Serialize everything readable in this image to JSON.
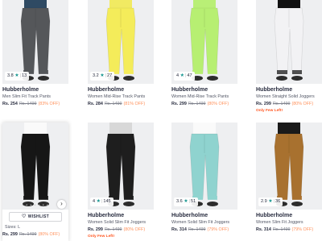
{
  "colors": {
    "accent_star": "#14958f",
    "discount": "#ff905a",
    "few_left": "#ff5722"
  },
  "products": [
    {
      "id": "p1",
      "brand": "Hubberholme",
      "title": "Men Slim Fit Track Pants",
      "price": "Rs. 254",
      "mrp": "Rs. 1499",
      "discount": "(83% OFF)",
      "rating": "3.8",
      "count": "13",
      "few_left": "",
      "garment_color": "#55575a",
      "top_color": "#2f4a63"
    },
    {
      "id": "p2",
      "brand": "Hubberholme",
      "title": "Women Mid-Rise Track Pants",
      "price": "Rs. 284",
      "mrp": "Rs. 1499",
      "discount": "(81% OFF)",
      "rating": "3.2",
      "count": "27",
      "few_left": "",
      "garment_color": "#f4ec5a",
      "top_color": "#f1ea62"
    },
    {
      "id": "p3",
      "brand": "Hubberholme",
      "title": "Women Mid-Rise Track Pants",
      "price": "Rs. 299",
      "mrp": "Rs. 1499",
      "discount": "(80% OFF)",
      "rating": "4",
      "count": "47",
      "few_left": "",
      "garment_color": "#b7ef72",
      "top_color": "#b9ef76"
    },
    {
      "id": "p4",
      "brand": "Hubberholme",
      "title": "Women Straight Solid Joggers",
      "price": "Rs. 299",
      "mrp": "Rs. 1499",
      "discount": "(80% OFF)",
      "rating": "",
      "count": "",
      "few_left": "Only Few Left!",
      "garment_color": "#f2f2f4",
      "top_color": "#111111"
    },
    {
      "id": "p5",
      "brand": "",
      "title": "",
      "price": "Rs. 299",
      "mrp": "Rs. 1499",
      "discount": "(80% OFF)",
      "rating": "",
      "count": "",
      "few_left": "",
      "garment_color": "#161616",
      "top_color": "#fafafa",
      "wishlist_label": "WISHLIST",
      "sizes_label": "Sizes: L",
      "dots": "• • • • • • •",
      "next_arrow": "›"
    },
    {
      "id": "p6",
      "brand": "Hubberholme",
      "title": "Women Solid Slim Fit Joggers",
      "price": "Rs. 299",
      "mrp": "Rs. 1499",
      "discount": "(80% OFF)",
      "rating": "4",
      "count": "145",
      "few_left": "Only Few Left!",
      "garment_color": "#1e1e1e",
      "top_color": "#d8d8d8"
    },
    {
      "id": "p7",
      "brand": "Hubberholme",
      "title": "Women Solid Slim Fit Joggers",
      "price": "Rs. 314",
      "mrp": "Rs. 1499",
      "discount": "(79% OFF)",
      "rating": "3.6",
      "count": "51",
      "few_left": "",
      "garment_color": "#8fd3cf",
      "top_color": "#fafafa"
    },
    {
      "id": "p8",
      "brand": "Hubberholme",
      "title": "Women Slim Fit Joggers",
      "price": "Rs. 314",
      "mrp": "Rs. 1499",
      "discount": "(79% OFF)",
      "rating": "2.9",
      "count": "36",
      "few_left": "",
      "garment_color": "#a8712f",
      "top_color": "#1a1a1a"
    }
  ]
}
